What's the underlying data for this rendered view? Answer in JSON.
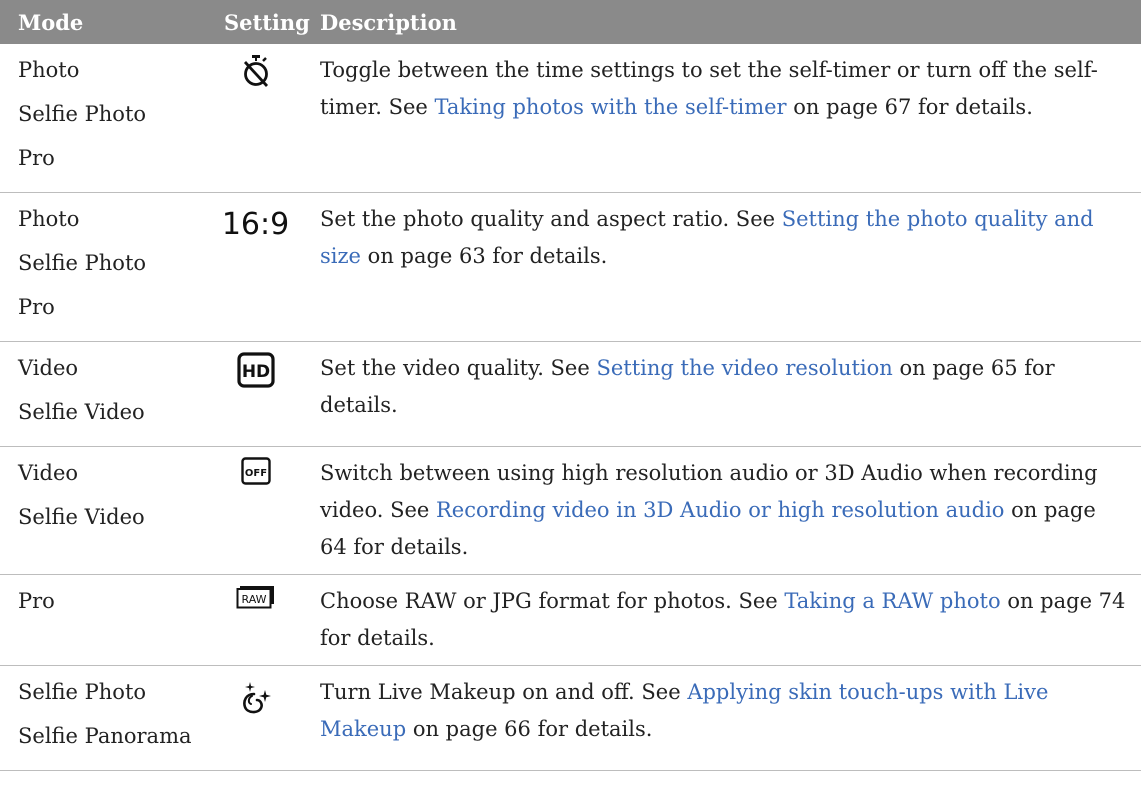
{
  "header": {
    "mode": "Mode",
    "setting": "Setting",
    "description": "Description"
  },
  "rows": [
    {
      "modes": [
        "Photo",
        "Selfie Photo",
        "Pro"
      ],
      "icon": "self-timer-off-icon",
      "desc": [
        {
          "text": "Toggle between the time settings to set the self-timer or turn off the self-timer. See ",
          "link": false
        },
        {
          "text": "Taking photos with the self-timer",
          "link": true
        },
        {
          "text": " on page 67 for details.",
          "link": false
        }
      ]
    },
    {
      "modes": [
        "Photo",
        "Selfie Photo",
        "Pro"
      ],
      "icon": "aspect-ratio-icon",
      "icon_text": "16:9",
      "desc": [
        {
          "text": "Set the photo quality and aspect ratio. See ",
          "link": false
        },
        {
          "text": "Setting the photo quality and size",
          "link": true
        },
        {
          "text": " on page 63 for details.",
          "link": false
        }
      ]
    },
    {
      "modes": [
        "Video",
        "Selfie Video"
      ],
      "icon": "hd-video-quality-icon",
      "icon_text": "HD",
      "desc": [
        {
          "text": "Set the video quality. See ",
          "link": false
        },
        {
          "text": "Setting the video resolution",
          "link": true
        },
        {
          "text": " on page 65 for details.",
          "link": false
        }
      ]
    },
    {
      "modes": [
        "Video",
        "Selfie Video"
      ],
      "icon": "audio-off-icon",
      "icon_text": "OFF",
      "desc": [
        {
          "text": "Switch between using high resolution audio or 3D Audio when recording video. See ",
          "link": false
        },
        {
          "text": "Recording video in 3D Audio or high resolution audio",
          "link": true
        },
        {
          "text": " on page 64 for details.",
          "link": false
        }
      ]
    },
    {
      "modes": [
        "Pro"
      ],
      "icon": "raw-format-icon",
      "icon_text": "RAW",
      "desc": [
        {
          "text": "Choose RAW or JPG format for photos. See ",
          "link": false
        },
        {
          "text": "Taking a RAW photo",
          "link": true
        },
        {
          "text": " on page 74 for details.",
          "link": false
        }
      ]
    },
    {
      "modes": [
        "Selfie Photo",
        "Selfie Panorama"
      ],
      "icon": "live-makeup-icon",
      "desc": [
        {
          "text": "Turn Live Makeup on and off. See ",
          "link": false
        },
        {
          "text": "Applying skin touch-ups with Live Makeup",
          "link": true
        },
        {
          "text": " on page 66 for details.",
          "link": false
        }
      ]
    }
  ],
  "colors": {
    "header_bg": "#8a8a8a",
    "link": "#3a6bb8",
    "text": "#222222",
    "row_divider": "#bdbdbd"
  }
}
